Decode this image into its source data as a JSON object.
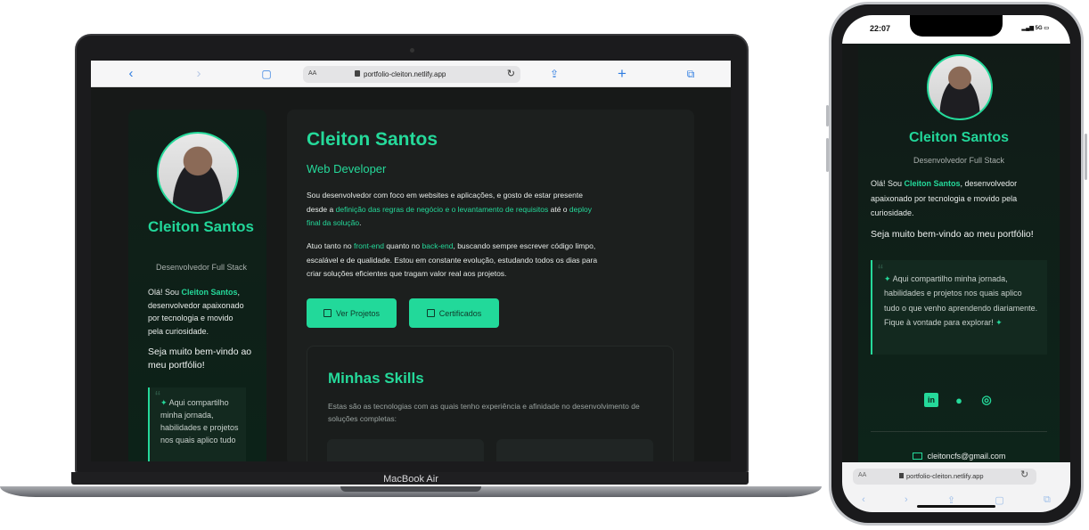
{
  "laptop": {
    "model_label": "MacBook Air",
    "browser": {
      "url": "portfolio-cleiton.netlify.app",
      "aa": "AA",
      "icons": [
        "back-icon",
        "forward-icon",
        "bookmarks-icon",
        "reload-icon",
        "share-icon",
        "new-tab-icon",
        "tabs-icon"
      ]
    },
    "sidebar": {
      "name": "Cleiton Santos",
      "role": "Desenvolvedor Full Stack",
      "bio_prefix": "Olá! Sou ",
      "bio_highlight": "Cleiton Santos",
      "bio_suffix": ", desenvolvedor apaixonado por tecnologia e movido pela curiosidade.",
      "welcome": "Seja muito bem-vindo ao meu portfólio!",
      "quote": "Aqui compartilho minha jornada, habilidades e projetos nos quais aplico tudo"
    },
    "main": {
      "name": "Cleiton Santos",
      "role": "Web Developer",
      "p1_a": "Sou desenvolvedor com foco em websites e aplicações, e gosto de estar presente desde a ",
      "p1_link1": "definição das regras de negócio e o levantamento de requisitos",
      "p1_b": " até o ",
      "p1_link2": "deploy final da solução",
      "p1_c": ".",
      "p2_a": "Atuo tanto no ",
      "p2_link1": "front-end",
      "p2_b": " quanto no ",
      "p2_link2": "back-end",
      "p2_c": ", buscando sempre escrever código limpo, escalável e de qualidade. Estou em constante evolução, estudando todos os dias para criar soluções eficientes que tragam valor real aos projetos.",
      "btn_projects": "Ver Projetos",
      "btn_certificates": "Certificados",
      "skills_title": "Minhas Skills",
      "skills_desc": "Estas são as tecnologias com as quais tenho experiência e afinidade no desenvolvimento de soluções completas:"
    }
  },
  "phone": {
    "time": "22:07",
    "network": "5G",
    "name": "Cleiton Santos",
    "role": "Desenvolvedor Full Stack",
    "bio_prefix": "Olá! Sou ",
    "bio_highlight": "Cleiton Santos",
    "bio_suffix": ", desenvolvedor apaixonado por tecnologia e movido pela curiosidade.",
    "welcome": "Seja muito bem-vindo ao meu portfólio!",
    "quote": "Aqui compartilho minha jornada, habilidades e projetos nos quais aplico tudo o que venho aprendendo diariamente. Fique à vontade para explorar!",
    "email": "cleitoncfs@gmail.com",
    "url": "portfolio-cleiton.netlify.app",
    "aa": "AA",
    "social_icons": [
      "linkedin-icon",
      "github-icon",
      "whatsapp-icon"
    ]
  },
  "colors": {
    "accent": "#25d99a",
    "background": "#171918",
    "card": "#1c1f1e"
  }
}
